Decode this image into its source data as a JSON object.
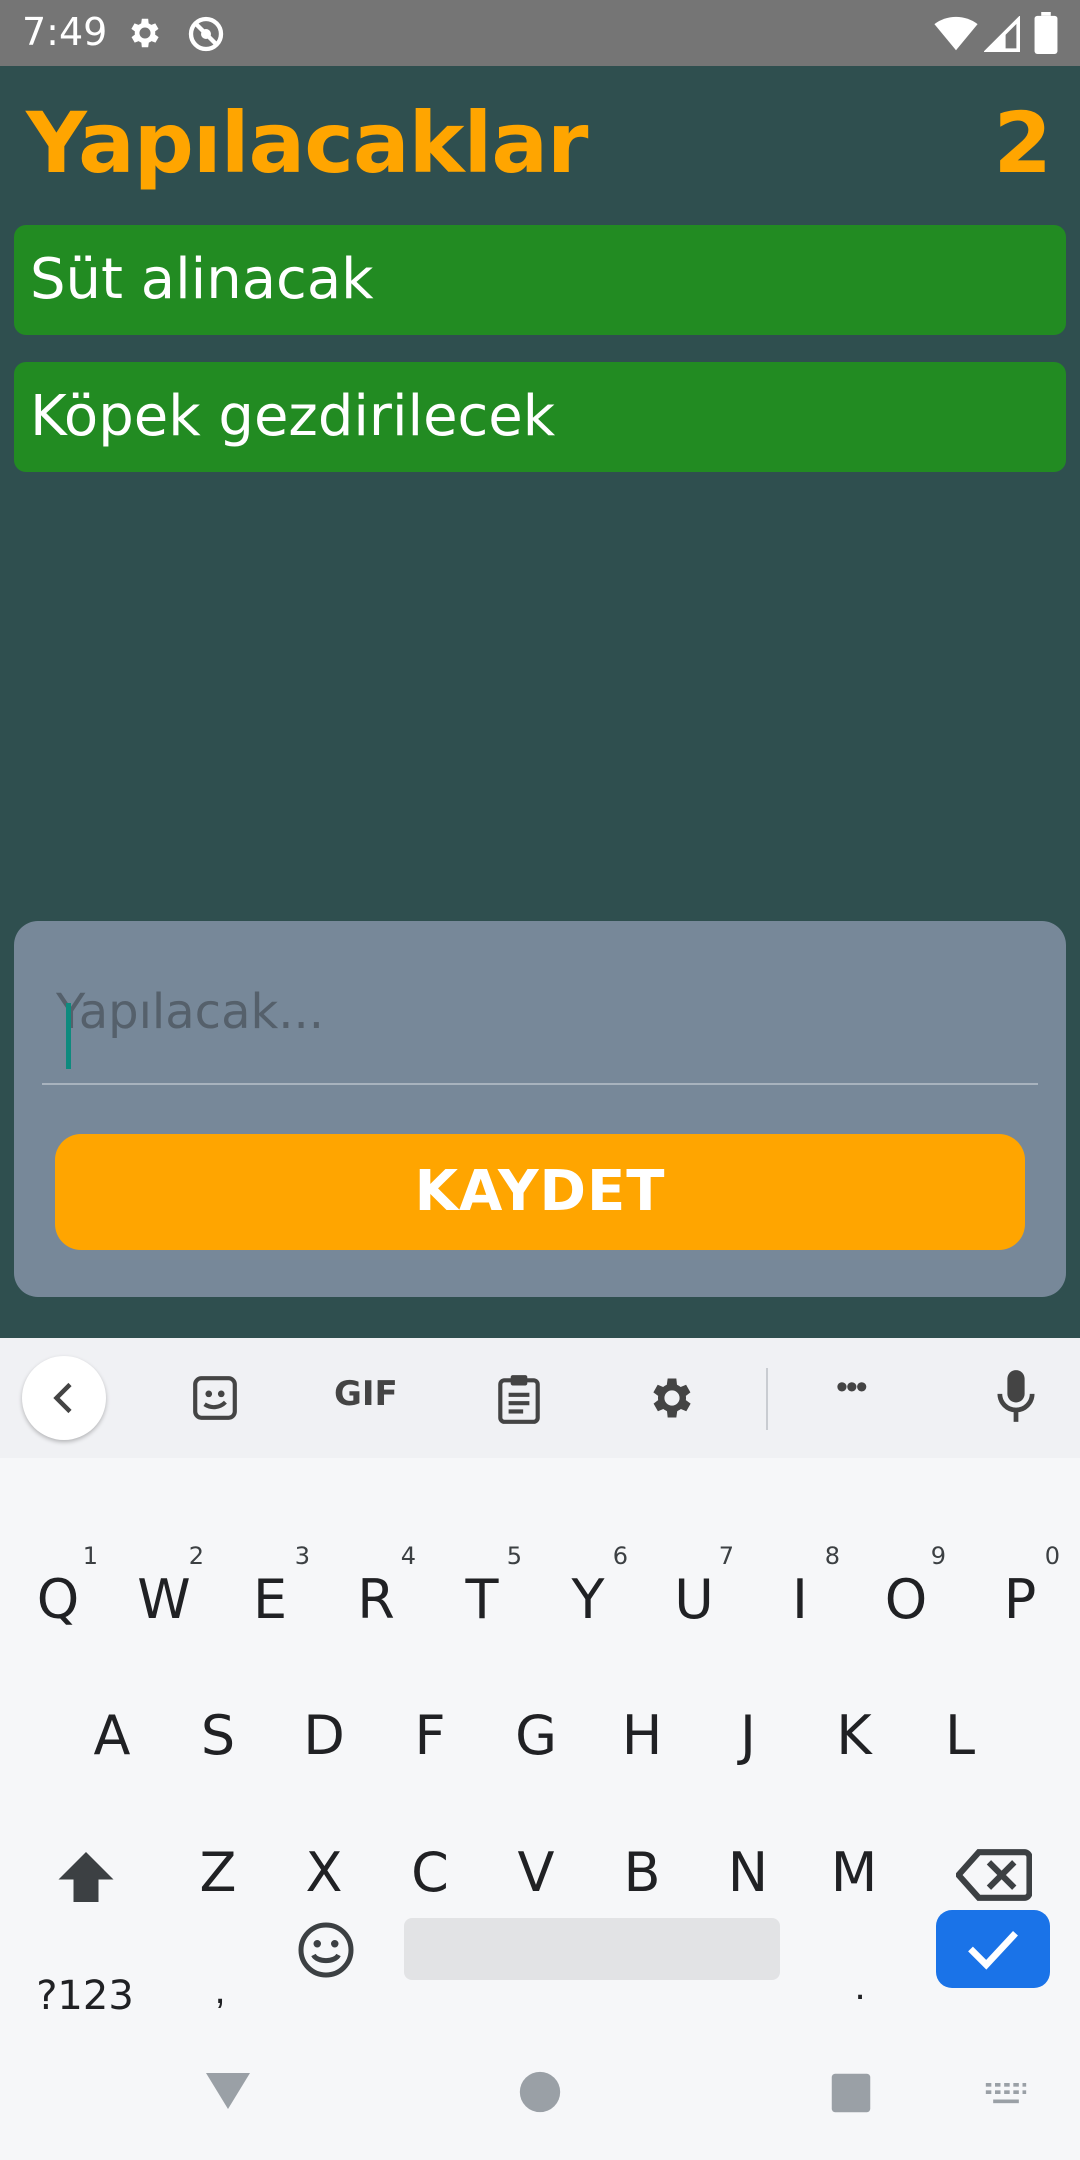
{
  "status_bar": {
    "time": "7:49",
    "icons": [
      "gear-icon",
      "no-sync-icon",
      "wifi-icon",
      "signal-icon",
      "battery-icon"
    ]
  },
  "app": {
    "title": "Yapılacaklar",
    "count": "2",
    "todos": [
      {
        "text": "Süt alinacak"
      },
      {
        "text": "Köpek gezdirilecek"
      }
    ],
    "input": {
      "placeholder": "Yapılacak...",
      "value": ""
    },
    "save_label": "KAYDET",
    "colors": {
      "background": "#2f4f4f",
      "accent": "#ffa500",
      "todo_bg": "#228b22",
      "card_bg": "#778899"
    }
  },
  "keyboard": {
    "toolbar_icons": [
      "back-arrow-icon",
      "sticker-icon",
      "gif-icon",
      "clipboard-icon",
      "settings-icon",
      "more-icon",
      "mic-icon"
    ],
    "gif_label": "GIF",
    "more_label": "•••",
    "row1": [
      {
        "key": "Q",
        "hint": "1"
      },
      {
        "key": "W",
        "hint": "2"
      },
      {
        "key": "E",
        "hint": "3"
      },
      {
        "key": "R",
        "hint": "4"
      },
      {
        "key": "T",
        "hint": "5"
      },
      {
        "key": "Y",
        "hint": "6"
      },
      {
        "key": "U",
        "hint": "7"
      },
      {
        "key": "I",
        "hint": "8"
      },
      {
        "key": "O",
        "hint": "9"
      },
      {
        "key": "P",
        "hint": "0"
      }
    ],
    "row2": [
      "A",
      "S",
      "D",
      "F",
      "G",
      "H",
      "J",
      "K",
      "L"
    ],
    "row3": [
      "Z",
      "X",
      "C",
      "V",
      "B",
      "N",
      "M"
    ],
    "symbols_label": "?123",
    "comma_label": ",",
    "period_label": "."
  }
}
